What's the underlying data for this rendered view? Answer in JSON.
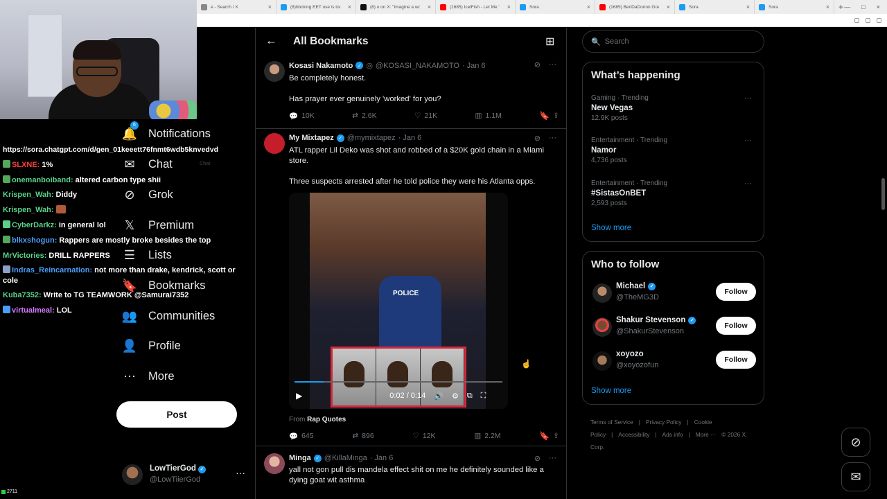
{
  "browser": {
    "tabs": [
      {
        "title": "e - Search / X",
        "color": "#888"
      },
      {
        "title": "(8)bbcking EET use is too high, a",
        "color": "#1d9bf0"
      },
      {
        "title": "(8) o on X: \"Imagine a world htt:",
        "color": "#111"
      },
      {
        "title": "(1685) IcelFish - Let Me Tell You",
        "color": "#ff0000"
      },
      {
        "title": "Sora",
        "color": "#1d9bf0"
      },
      {
        "title": "(1685) BenDaDonnn Goes to So",
        "color": "#ff0000"
      },
      {
        "title": "Sora",
        "color": "#1d9bf0"
      },
      {
        "title": "Sora",
        "color": "#1d9bf0"
      }
    ],
    "chat_label": "Chat"
  },
  "stream_chat": {
    "url": "https://sora.chatgpt.com/d/gen_01keeett76fnmt6wdb5knvedvd",
    "messages": [
      {
        "user": "SLXNE:",
        "text": "1%",
        "color": "#ff3b3b",
        "badge": "#54a85c"
      },
      {
        "user": "onemanboiband:",
        "text": "altered carbon type shii",
        "color": "#5ad18a",
        "badge": "#54a85c"
      },
      {
        "user": "Krispen_Wah:",
        "text": "Diddy",
        "color": "#5ad18a",
        "badge": ""
      },
      {
        "user": "Krispen_Wah:",
        "text": "",
        "color": "#5ad18a",
        "badge": "",
        "emote": true
      },
      {
        "user": "CyberDarkz:",
        "text": "in general lol",
        "color": "#5ad18a",
        "badge": "#5ad18a"
      },
      {
        "user": "blkxshogun:",
        "text": "Rappers are mostly broke besides the top",
        "color": "#4a9df8",
        "badge": "#54a85c"
      },
      {
        "user": "MrVictories:",
        "text": "DRILL RAPPERS",
        "color": "#5ad18a",
        "badge": ""
      },
      {
        "user": "Indras_Reincarnation:",
        "text": "not more than drake, kendrick, scott or cole",
        "color": "#4a9df8",
        "badge": "#8aa0c8",
        "wrap": true
      },
      {
        "user": "Kuba7352:",
        "text": "Write to TG TEAMWORK @Samurai7352",
        "color": "#5ad18a",
        "badge": ""
      },
      {
        "user": "virtualmeal:",
        "text": "LOL",
        "color": "#d77bff",
        "badge": "#4a9df8"
      }
    ],
    "counter": "2711"
  },
  "nav": {
    "notifications_badge": "6",
    "items": [
      {
        "label": "Notifications",
        "icon": "🔔",
        "name": "notifications"
      },
      {
        "label": "Chat",
        "icon": "✉",
        "name": "chat"
      },
      {
        "label": "Grok",
        "icon": "⊘",
        "name": "grok"
      },
      {
        "label": "Premium",
        "icon": "𝕏",
        "name": "premium"
      },
      {
        "label": "Lists",
        "icon": "☰",
        "name": "lists"
      },
      {
        "label": "Bookmarks",
        "icon": "🔖",
        "name": "bookmarks"
      },
      {
        "label": "Communities",
        "icon": "👥",
        "name": "communities"
      },
      {
        "label": "Profile",
        "icon": "👤",
        "name": "profile"
      },
      {
        "label": "More",
        "icon": "⋯",
        "name": "more"
      }
    ],
    "post_label": "Post",
    "account": {
      "name": "LowTierGod",
      "handle": "@LowTiierGod"
    }
  },
  "main": {
    "title": "All Bookmarks",
    "tweets": [
      {
        "name": "Kosasi Nakamoto",
        "handle": "@KOSASI_NAKAMOTO",
        "date": "· Jan 6",
        "lines": [
          "Be completely honest.",
          "",
          "Has prayer ever genuinely 'worked' for you?"
        ],
        "replies": "10K",
        "reposts": "2.6K",
        "likes": "21K",
        "views": "1.1M"
      },
      {
        "name": "My Mixtapez",
        "handle": "@mymixtapez",
        "date": "· Jan 6",
        "lines": [
          "ATL rapper Lil Deko was shot and robbed of a $20K gold chain in a Miami store.",
          "",
          "Three suspects arrested after he told police they were his Atlanta opps."
        ],
        "video_time": "0:02 / 0:14",
        "video_progress": 0.14,
        "video_text": "POLICE",
        "from_label": "From",
        "from_source": "Rap Quotes",
        "replies": "645",
        "reposts": "896",
        "likes": "12K",
        "views": "2.2M"
      },
      {
        "name": "Minga",
        "handle": "@KillaMinga",
        "date": "· Jan 6",
        "lines": [
          "yall not gon pull dis mandela effect shit on me he definitely sounded like a dying goat wit asthma"
        ]
      }
    ]
  },
  "sidebar": {
    "search_placeholder": "Search",
    "whats_happening": "What’s happening",
    "trends": [
      {
        "category": "Gaming · Trending",
        "name": "New Vegas",
        "count": "12.9K posts"
      },
      {
        "category": "Entertainment · Trending",
        "name": "Namor",
        "count": "4,736 posts"
      },
      {
        "category": "Entertainment · Trending",
        "name": "#SistasOnBET",
        "count": "2,593 posts"
      }
    ],
    "show_more": "Show more",
    "who_to_follow": "Who to follow",
    "follow_suggestions": [
      {
        "name": "Michael",
        "handle": "@TheMG3D",
        "verified": true
      },
      {
        "name": "Shakur Stevenson",
        "handle": "@ShakurStevenson",
        "verified": true
      },
      {
        "name": "xoyozo",
        "handle": "@xoyozofun",
        "verified": false
      }
    ],
    "follow_label": "Follow",
    "footer": [
      "Terms of Service",
      "|",
      "Privacy Policy",
      "|",
      "Cookie Policy",
      "|",
      "Accessibility",
      "|",
      "Ads info",
      "|",
      "More ···",
      "© 2026 X Corp."
    ]
  }
}
